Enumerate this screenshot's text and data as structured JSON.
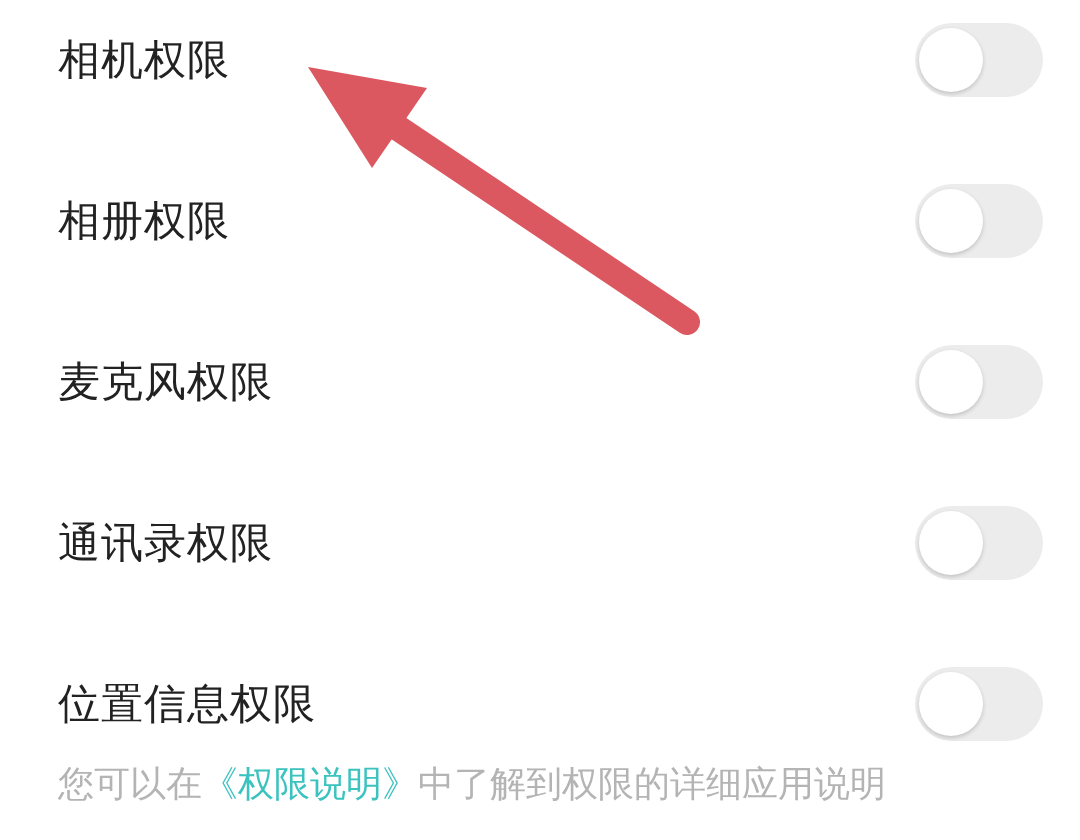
{
  "permissions": [
    {
      "label": "相机权限",
      "on": false
    },
    {
      "label": "相册权限",
      "on": false
    },
    {
      "label": "麦克风权限",
      "on": false
    },
    {
      "label": "通讯录权限",
      "on": false
    },
    {
      "label": "位置信息权限",
      "on": false
    }
  ],
  "note": {
    "text_before": "您可以在",
    "link": "《权限说明》",
    "text_after": "中了解到权限的详细应用说明"
  }
}
